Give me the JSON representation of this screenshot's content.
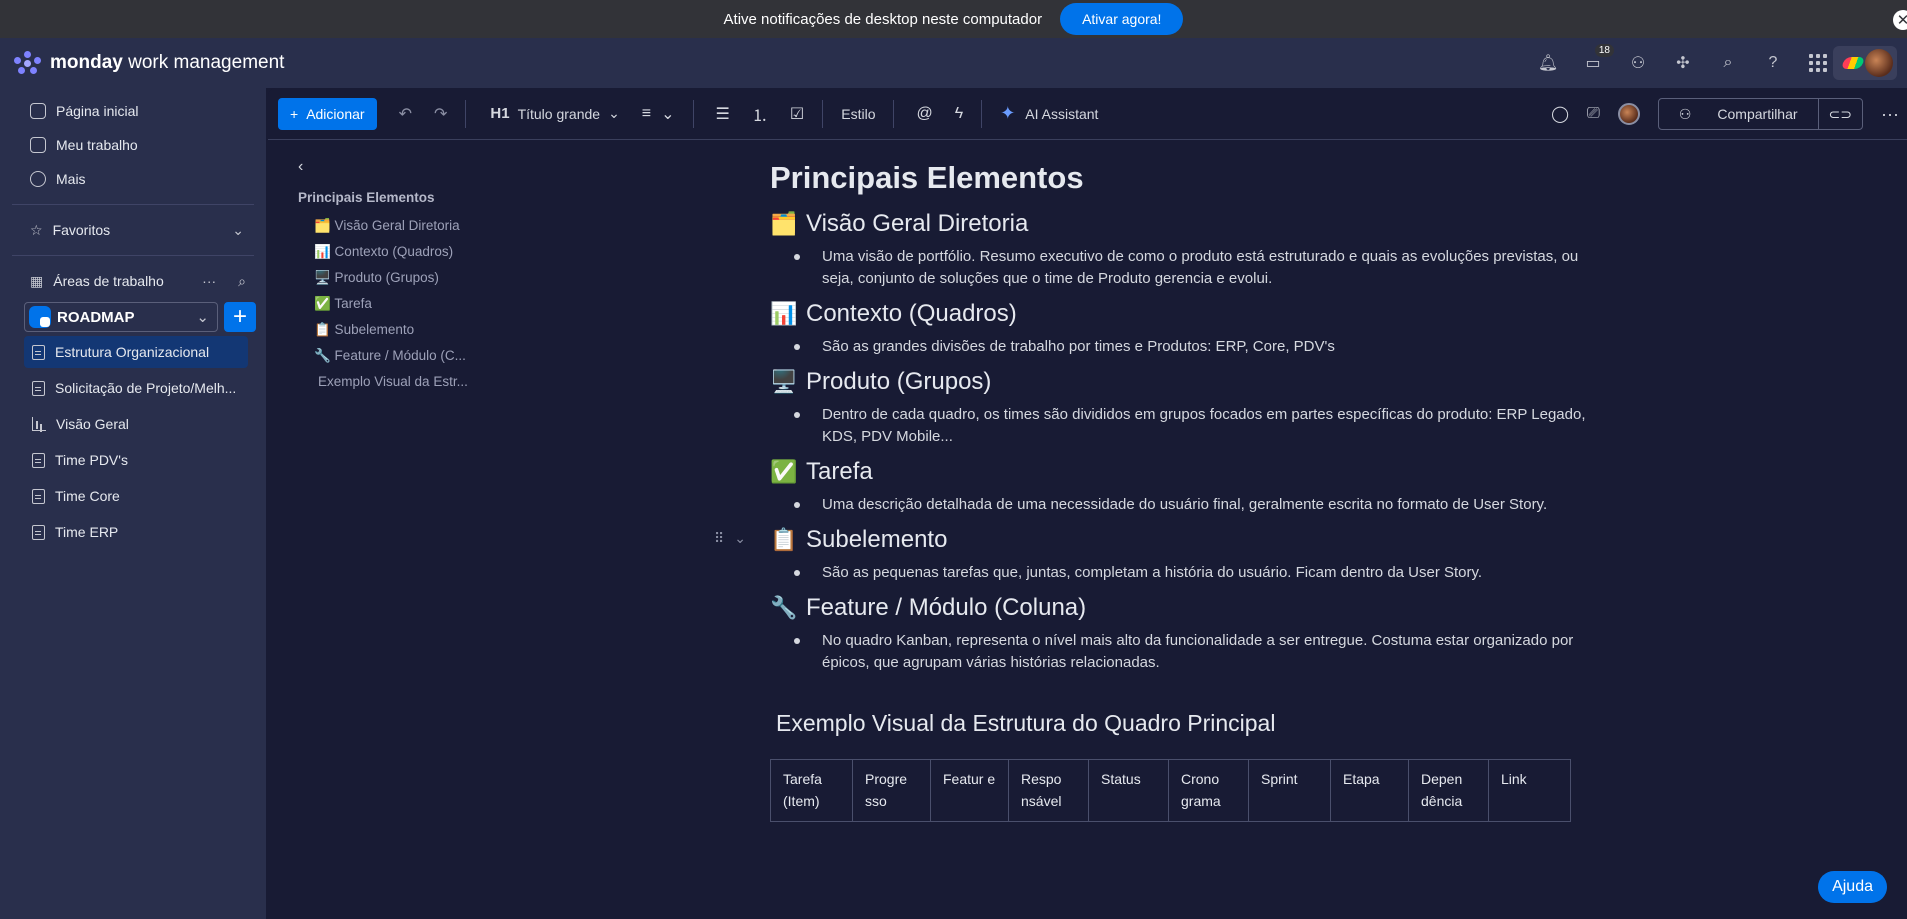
{
  "notification": {
    "text": "Ative notificações de desktop neste computador",
    "button": "Ativar agora!",
    "close": "✕"
  },
  "topbar": {
    "brand_bold": "monday",
    "brand_rest": " work management",
    "inbox_badge": "18",
    "help": "?"
  },
  "sidebar": {
    "nav": [
      "Página inicial",
      "Meu trabalho",
      "Mais"
    ],
    "favorites": "Favoritos",
    "workspaces": "Áreas de trabalho",
    "workspace_name": "ROADMAP",
    "add": "+",
    "boards": [
      {
        "label": "Estrutura Organizacional",
        "type": "doc"
      },
      {
        "label": "Solicitação de Projeto/Melh...",
        "type": "doc"
      },
      {
        "label": "Visão Geral",
        "type": "chart"
      },
      {
        "label": "Time PDV's",
        "type": "doc"
      },
      {
        "label": "Time Core",
        "type": "doc"
      },
      {
        "label": "Time ERP",
        "type": "doc"
      }
    ]
  },
  "toolbar": {
    "add": "Adicionar",
    "heading": "Título grande",
    "heading_prefix": "H1",
    "style": "Estilo",
    "ai": "AI Assistant",
    "share": "Compartilhar"
  },
  "toc": {
    "title": "Principais Elementos",
    "items": [
      "🗂️ Visão Geral Diretoria",
      "📊 Contexto (Quadros)",
      "🖥️ Produto (Grupos)",
      "✅ Tarefa",
      "📋 Subelemento",
      "🔧 Feature / Módulo (C..."
    ],
    "extra": "Exemplo Visual da Estr..."
  },
  "document": {
    "title": "Principais Elementos",
    "sections": [
      {
        "emoji": "🗂️",
        "heading": "Visão Geral Diretoria",
        "bullet": "Uma visão de portfólio. Resumo executivo de como o produto está estruturado e quais as evoluções previstas, ou seja, conjunto de soluções que o time de Produto gerencia e evolui."
      },
      {
        "emoji": "📊",
        "heading": "Contexto (Quadros)",
        "bullet": "São as grandes divisões de trabalho por times e Produtos: ERP, Core, PDV's"
      },
      {
        "emoji": "🖥️",
        "heading": "Produto (Grupos)",
        "bullet": "Dentro de cada quadro, os times são divididos em grupos focados em partes específicas do produto: ERP Legado, KDS, PDV Mobile..."
      },
      {
        "emoji": "✅",
        "heading": "Tarefa",
        "bullet": "Uma descrição detalhada de uma necessidade do usuário final, geralmente escrita no formato de User Story."
      },
      {
        "emoji": "📋",
        "heading": "Subelemento",
        "bullet": "São as pequenas tarefas que, juntas, completam a história do usuário. Ficam dentro da User Story."
      },
      {
        "emoji": "🔧",
        "heading": "Feature / Módulo (Coluna)",
        "bullet": "No quadro Kanban, representa o nível mais alto da funcionalidade a ser entregue. Costuma estar organizado por épicos, que agrupam várias histórias relacionadas."
      }
    ],
    "example_title": "Exemplo Visual da Estrutura do Quadro Principal",
    "table_headers": [
      "Tarefa (Item)",
      "Progre sso",
      "Featur e",
      "Respo nsável",
      "Status",
      "Crono grama",
      "Sprint",
      "Etapa",
      "Depen dência",
      "Link"
    ]
  },
  "help": "Ajuda"
}
